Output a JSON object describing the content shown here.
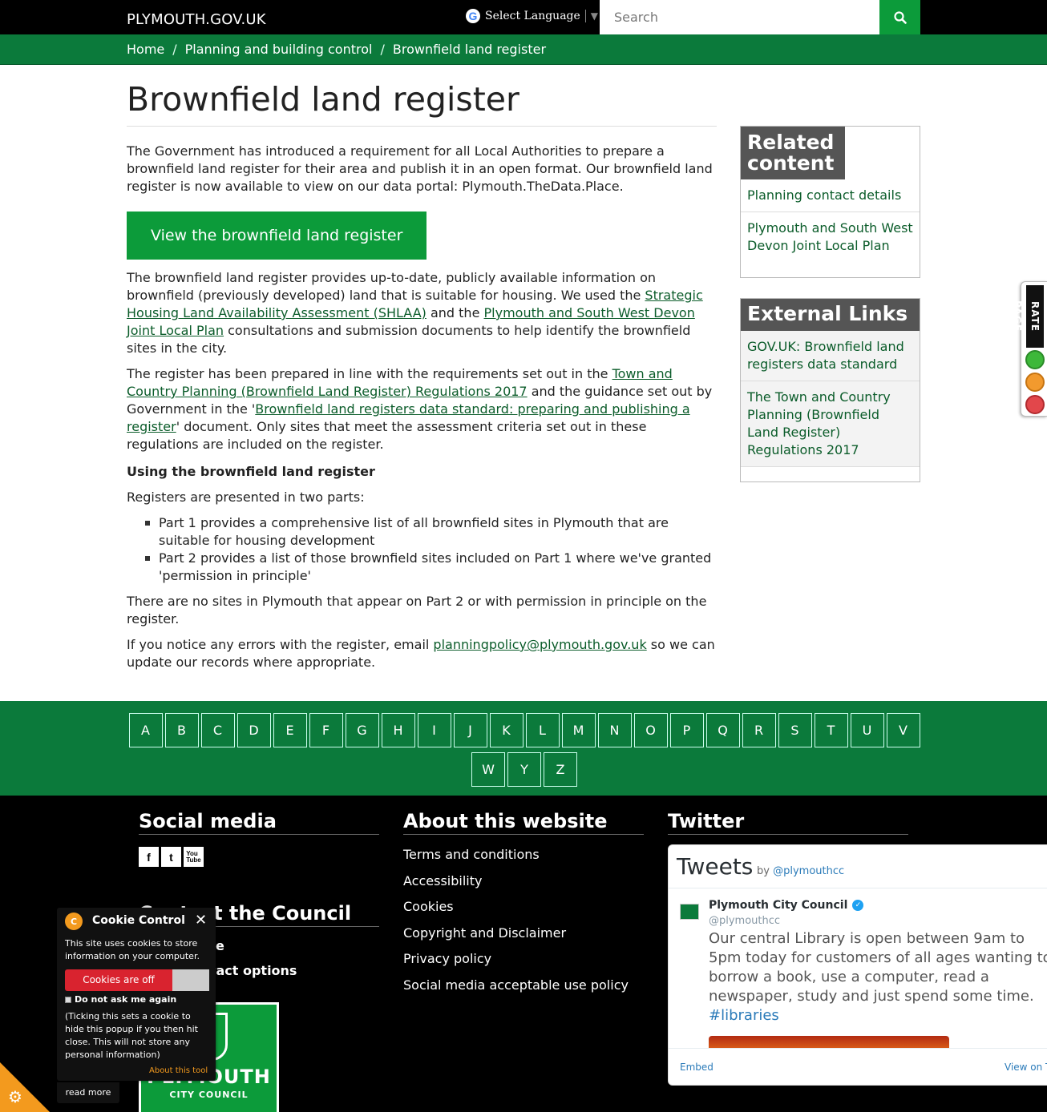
{
  "header": {
    "site_name": "PLYMOUTH.GOV.UK",
    "language_label": "Select Language",
    "search_placeholder": "Search"
  },
  "breadcrumb": [
    "Home",
    "Planning and building control",
    "Brownfield land register"
  ],
  "page": {
    "title": "Brownfield land register",
    "intro": "The Government has introduced a requirement for all Local Authorities to prepare a brownfield land register for their area and publish it in an open format. Our brownfield land register is now available to view on our data portal: Plymouth.TheData.Place.",
    "cta": "View the brownfield land register",
    "p2": {
      "a": "The brownfield land register provides up-to-date, publicly available information on brownfield (previously developed) land that is suitable for housing. We used the ",
      "link1": "Strategic Housing Land Availability Assessment (SHLAA)",
      "b": " and the ",
      "link2": "Plymouth and South West Devon Joint Local Plan",
      "c": " consultations and submission documents to help identify the brownfield sites in the city."
    },
    "p3": {
      "a": "The register has been prepared in line with the requirements set out in the ",
      "link1": "Town and Country Planning (Brownfield Land Register) Regulations 2017",
      "b": " and the guidance set out by Government in the '",
      "link2": "Brownfield land registers data standard: preparing and publishing a register",
      "c": "' document. Only sites that meet the assessment criteria set out in these regulations are included on the register."
    },
    "subheading": "Using the brownfield land register",
    "p4": "Registers are presented in two parts:",
    "list": [
      "Part 1 provides a comprehensive list of all brownfield sites in Plymouth that are suitable for housing development",
      "Part 2 provides a list of those brownfield sites included on Part 1 where we've granted 'permission in principle'"
    ],
    "p5": "There are no sites in Plymouth that appear on Part 2 or with permission in principle on the register.",
    "p6": {
      "a": "If you notice any errors with the register, email ",
      "email": "planningpolicy@plymouth.gov.uk",
      "b": " so we can update our records where appropriate."
    }
  },
  "sidebar": {
    "related_title": "Related content",
    "related": [
      "Planning contact details",
      "Plymouth and South West Devon Joint Local Plan"
    ],
    "external_title": "External Links",
    "external": [
      "GOV.UK: Brownfield land registers data standard",
      "The Town and Country Planning (Brownfield Land Register) Regulations 2017"
    ]
  },
  "rate_page": "RATE PAGE",
  "alphabet": [
    "A",
    "B",
    "C",
    "D",
    "E",
    "F",
    "G",
    "H",
    "I",
    "J",
    "K",
    "L",
    "M",
    "N",
    "O",
    "P",
    "Q",
    "R",
    "S",
    "T",
    "U",
    "V",
    "W",
    "Y",
    "Z"
  ],
  "footer": {
    "social_title": "Social media",
    "social_icons": [
      "facebook-icon",
      "twitter-icon",
      "youtube-icon"
    ],
    "social_glyphs": [
      "f",
      "t",
      "You\nTube"
    ],
    "contact_title": "Contact the Council",
    "contact_items": [
      "Self Service",
      "Other contact options"
    ],
    "about_title": "About this website",
    "about_links": [
      "Terms and conditions",
      "Accessibility",
      "Cookies",
      "Copyright and Disclaimer",
      "Privacy policy",
      "Social media acceptable use policy"
    ],
    "twitter_title": "Twitter",
    "logo_big": "PLYMOUTH",
    "logo_small": "CITY COUNCIL"
  },
  "twitter_widget": {
    "heading": "Tweets",
    "by": "by",
    "handle_link": "@plymouthcc",
    "name": "Plymouth City Council",
    "handle": "@plymouthcc",
    "text": "Our central Library is open between 9am to 5pm today for customers of all ages wanting to borrow a book, use a computer, read a newspaper, study and just spend some time.",
    "hashtag": "#libraries",
    "embed": "Embed",
    "view": "View on Twitter"
  },
  "cookie": {
    "title": "Cookie Control",
    "text": "This site uses cookies to store information on your computer.",
    "toggle": "Cookies are off",
    "checkbox": "Do not ask me again",
    "note": "(Ticking this sets a cookie to hide this popup if you then hit close. This will not store any personal information)",
    "about": "About this tool",
    "read_more": "read more"
  },
  "colors": {
    "primary_green": "#0b7a3b",
    "button_green": "#0c9b3a",
    "header_black": "#000000",
    "panel_grey": "#555555",
    "cookie_orange": "#f39a1e",
    "cookie_red": "#d9232f"
  }
}
